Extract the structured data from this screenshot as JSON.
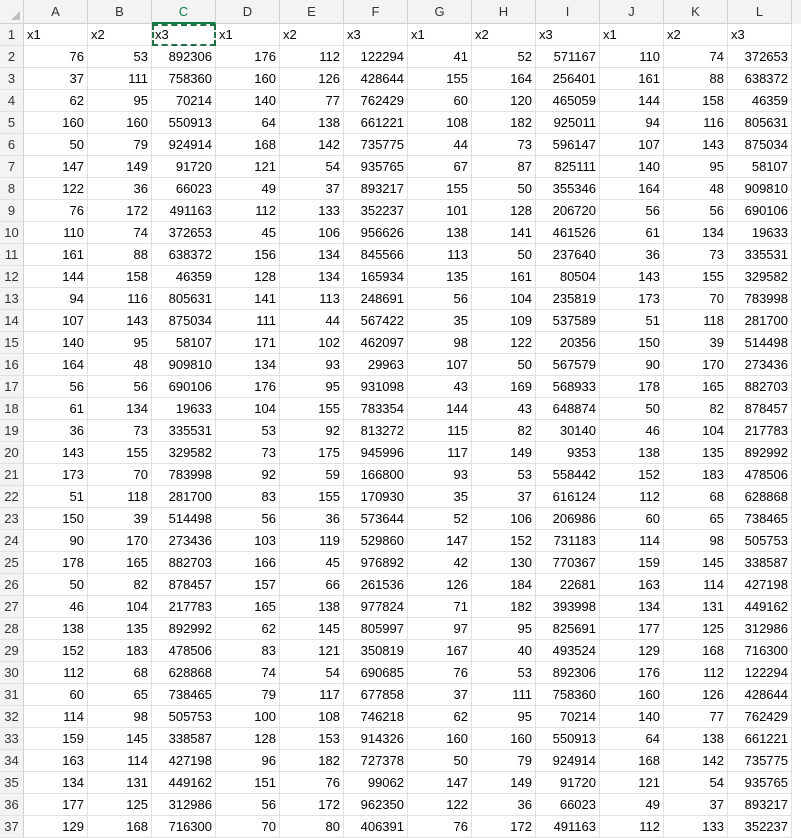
{
  "columns": [
    "A",
    "B",
    "C",
    "D",
    "E",
    "F",
    "G",
    "H",
    "I",
    "J",
    "K",
    "L"
  ],
  "selected_cell": "C1",
  "header_row": [
    "x1",
    "x2",
    "x3",
    "x1",
    "x2",
    "x3",
    "x1",
    "x2",
    "x3",
    "x1",
    "x2",
    "x3"
  ],
  "data_rows": [
    [
      76,
      53,
      892306,
      176,
      112,
      122294,
      41,
      52,
      571167,
      110,
      74,
      372653
    ],
    [
      37,
      111,
      758360,
      160,
      126,
      428644,
      155,
      164,
      256401,
      161,
      88,
      638372
    ],
    [
      62,
      95,
      70214,
      140,
      77,
      762429,
      60,
      120,
      465059,
      144,
      158,
      46359
    ],
    [
      160,
      160,
      550913,
      64,
      138,
      661221,
      108,
      182,
      925011,
      94,
      116,
      805631
    ],
    [
      50,
      79,
      924914,
      168,
      142,
      735775,
      44,
      73,
      596147,
      107,
      143,
      875034
    ],
    [
      147,
      149,
      91720,
      121,
      54,
      935765,
      67,
      87,
      825111,
      140,
      95,
      58107
    ],
    [
      122,
      36,
      66023,
      49,
      37,
      893217,
      155,
      50,
      355346,
      164,
      48,
      909810
    ],
    [
      76,
      172,
      491163,
      112,
      133,
      352237,
      101,
      128,
      206720,
      56,
      56,
      690106
    ],
    [
      110,
      74,
      372653,
      45,
      106,
      956626,
      138,
      141,
      461526,
      61,
      134,
      19633
    ],
    [
      161,
      88,
      638372,
      156,
      134,
      845566,
      113,
      50,
      237640,
      36,
      73,
      335531
    ],
    [
      144,
      158,
      46359,
      128,
      134,
      165934,
      135,
      161,
      80504,
      143,
      155,
      329582
    ],
    [
      94,
      116,
      805631,
      141,
      113,
      248691,
      56,
      104,
      235819,
      173,
      70,
      783998
    ],
    [
      107,
      143,
      875034,
      111,
      44,
      567422,
      35,
      109,
      537589,
      51,
      118,
      281700
    ],
    [
      140,
      95,
      58107,
      171,
      102,
      462097,
      98,
      122,
      20356,
      150,
      39,
      514498
    ],
    [
      164,
      48,
      909810,
      134,
      93,
      29963,
      107,
      50,
      567579,
      90,
      170,
      273436
    ],
    [
      56,
      56,
      690106,
      176,
      95,
      931098,
      43,
      169,
      568933,
      178,
      165,
      882703
    ],
    [
      61,
      134,
      19633,
      104,
      155,
      783354,
      144,
      43,
      648874,
      50,
      82,
      878457
    ],
    [
      36,
      73,
      335531,
      53,
      92,
      813272,
      115,
      82,
      30140,
      46,
      104,
      217783
    ],
    [
      143,
      155,
      329582,
      73,
      175,
      945996,
      117,
      149,
      9353,
      138,
      135,
      892992
    ],
    [
      173,
      70,
      783998,
      92,
      59,
      166800,
      93,
      53,
      558442,
      152,
      183,
      478506
    ],
    [
      51,
      118,
      281700,
      83,
      155,
      170930,
      35,
      37,
      616124,
      112,
      68,
      628868
    ],
    [
      150,
      39,
      514498,
      56,
      36,
      573644,
      52,
      106,
      206986,
      60,
      65,
      738465
    ],
    [
      90,
      170,
      273436,
      103,
      119,
      529860,
      147,
      152,
      731183,
      114,
      98,
      505753
    ],
    [
      178,
      165,
      882703,
      166,
      45,
      976892,
      42,
      130,
      770367,
      159,
      145,
      338587
    ],
    [
      50,
      82,
      878457,
      157,
      66,
      261536,
      126,
      184,
      22681,
      163,
      114,
      427198
    ],
    [
      46,
      104,
      217783,
      165,
      138,
      977824,
      71,
      182,
      393998,
      134,
      131,
      449162
    ],
    [
      138,
      135,
      892992,
      62,
      145,
      805997,
      97,
      95,
      825691,
      177,
      125,
      312986
    ],
    [
      152,
      183,
      478506,
      83,
      121,
      350819,
      167,
      40,
      493524,
      129,
      168,
      716300
    ],
    [
      112,
      68,
      628868,
      74,
      54,
      690685,
      76,
      53,
      892306,
      176,
      112,
      122294
    ],
    [
      60,
      65,
      738465,
      79,
      117,
      677858,
      37,
      111,
      758360,
      160,
      126,
      428644
    ],
    [
      114,
      98,
      505753,
      100,
      108,
      746218,
      62,
      95,
      70214,
      140,
      77,
      762429
    ],
    [
      159,
      145,
      338587,
      128,
      153,
      914326,
      160,
      160,
      550913,
      64,
      138,
      661221
    ],
    [
      163,
      114,
      427198,
      96,
      182,
      727378,
      50,
      79,
      924914,
      168,
      142,
      735775
    ],
    [
      134,
      131,
      449162,
      151,
      76,
      99062,
      147,
      149,
      91720,
      121,
      54,
      935765
    ],
    [
      177,
      125,
      312986,
      56,
      172,
      962350,
      122,
      36,
      66023,
      49,
      37,
      893217
    ],
    [
      129,
      168,
      716300,
      70,
      80,
      406391,
      76,
      172,
      491163,
      112,
      133,
      352237
    ]
  ]
}
